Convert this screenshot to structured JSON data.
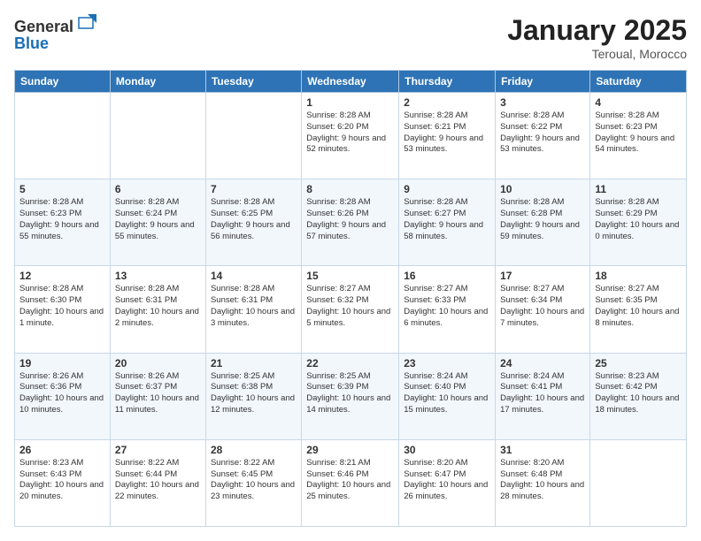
{
  "header": {
    "logo_line1": "General",
    "logo_line2": "Blue",
    "month_title": "January 2025",
    "location": "Teroual, Morocco"
  },
  "days_of_week": [
    "Sunday",
    "Monday",
    "Tuesday",
    "Wednesday",
    "Thursday",
    "Friday",
    "Saturday"
  ],
  "weeks": [
    [
      {
        "day": "",
        "content": ""
      },
      {
        "day": "",
        "content": ""
      },
      {
        "day": "",
        "content": ""
      },
      {
        "day": "1",
        "content": "Sunrise: 8:28 AM\nSunset: 6:20 PM\nDaylight: 9 hours\nand 52 minutes."
      },
      {
        "day": "2",
        "content": "Sunrise: 8:28 AM\nSunset: 6:21 PM\nDaylight: 9 hours\nand 53 minutes."
      },
      {
        "day": "3",
        "content": "Sunrise: 8:28 AM\nSunset: 6:22 PM\nDaylight: 9 hours\nand 53 minutes."
      },
      {
        "day": "4",
        "content": "Sunrise: 8:28 AM\nSunset: 6:23 PM\nDaylight: 9 hours\nand 54 minutes."
      }
    ],
    [
      {
        "day": "5",
        "content": "Sunrise: 8:28 AM\nSunset: 6:23 PM\nDaylight: 9 hours\nand 55 minutes."
      },
      {
        "day": "6",
        "content": "Sunrise: 8:28 AM\nSunset: 6:24 PM\nDaylight: 9 hours\nand 55 minutes."
      },
      {
        "day": "7",
        "content": "Sunrise: 8:28 AM\nSunset: 6:25 PM\nDaylight: 9 hours\nand 56 minutes."
      },
      {
        "day": "8",
        "content": "Sunrise: 8:28 AM\nSunset: 6:26 PM\nDaylight: 9 hours\nand 57 minutes."
      },
      {
        "day": "9",
        "content": "Sunrise: 8:28 AM\nSunset: 6:27 PM\nDaylight: 9 hours\nand 58 minutes."
      },
      {
        "day": "10",
        "content": "Sunrise: 8:28 AM\nSunset: 6:28 PM\nDaylight: 9 hours\nand 59 minutes."
      },
      {
        "day": "11",
        "content": "Sunrise: 8:28 AM\nSunset: 6:29 PM\nDaylight: 10 hours\nand 0 minutes."
      }
    ],
    [
      {
        "day": "12",
        "content": "Sunrise: 8:28 AM\nSunset: 6:30 PM\nDaylight: 10 hours\nand 1 minute."
      },
      {
        "day": "13",
        "content": "Sunrise: 8:28 AM\nSunset: 6:31 PM\nDaylight: 10 hours\nand 2 minutes."
      },
      {
        "day": "14",
        "content": "Sunrise: 8:28 AM\nSunset: 6:31 PM\nDaylight: 10 hours\nand 3 minutes."
      },
      {
        "day": "15",
        "content": "Sunrise: 8:27 AM\nSunset: 6:32 PM\nDaylight: 10 hours\nand 5 minutes."
      },
      {
        "day": "16",
        "content": "Sunrise: 8:27 AM\nSunset: 6:33 PM\nDaylight: 10 hours\nand 6 minutes."
      },
      {
        "day": "17",
        "content": "Sunrise: 8:27 AM\nSunset: 6:34 PM\nDaylight: 10 hours\nand 7 minutes."
      },
      {
        "day": "18",
        "content": "Sunrise: 8:27 AM\nSunset: 6:35 PM\nDaylight: 10 hours\nand 8 minutes."
      }
    ],
    [
      {
        "day": "19",
        "content": "Sunrise: 8:26 AM\nSunset: 6:36 PM\nDaylight: 10 hours\nand 10 minutes."
      },
      {
        "day": "20",
        "content": "Sunrise: 8:26 AM\nSunset: 6:37 PM\nDaylight: 10 hours\nand 11 minutes."
      },
      {
        "day": "21",
        "content": "Sunrise: 8:25 AM\nSunset: 6:38 PM\nDaylight: 10 hours\nand 12 minutes."
      },
      {
        "day": "22",
        "content": "Sunrise: 8:25 AM\nSunset: 6:39 PM\nDaylight: 10 hours\nand 14 minutes."
      },
      {
        "day": "23",
        "content": "Sunrise: 8:24 AM\nSunset: 6:40 PM\nDaylight: 10 hours\nand 15 minutes."
      },
      {
        "day": "24",
        "content": "Sunrise: 8:24 AM\nSunset: 6:41 PM\nDaylight: 10 hours\nand 17 minutes."
      },
      {
        "day": "25",
        "content": "Sunrise: 8:23 AM\nSunset: 6:42 PM\nDaylight: 10 hours\nand 18 minutes."
      }
    ],
    [
      {
        "day": "26",
        "content": "Sunrise: 8:23 AM\nSunset: 6:43 PM\nDaylight: 10 hours\nand 20 minutes."
      },
      {
        "day": "27",
        "content": "Sunrise: 8:22 AM\nSunset: 6:44 PM\nDaylight: 10 hours\nand 22 minutes."
      },
      {
        "day": "28",
        "content": "Sunrise: 8:22 AM\nSunset: 6:45 PM\nDaylight: 10 hours\nand 23 minutes."
      },
      {
        "day": "29",
        "content": "Sunrise: 8:21 AM\nSunset: 6:46 PM\nDaylight: 10 hours\nand 25 minutes."
      },
      {
        "day": "30",
        "content": "Sunrise: 8:20 AM\nSunset: 6:47 PM\nDaylight: 10 hours\nand 26 minutes."
      },
      {
        "day": "31",
        "content": "Sunrise: 8:20 AM\nSunset: 6:48 PM\nDaylight: 10 hours\nand 28 minutes."
      },
      {
        "day": "",
        "content": ""
      }
    ]
  ]
}
